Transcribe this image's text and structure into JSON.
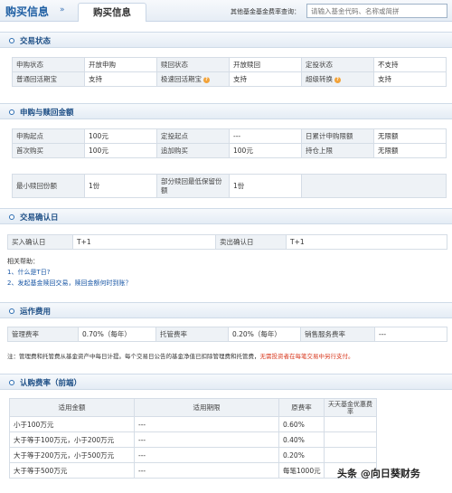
{
  "header": {
    "title": "购买信息",
    "double_arrow": "»",
    "tab": "购买信息",
    "query_label": "其他基金基金费率查询：",
    "search_placeholder": "请输入基金代码、名称或简拼"
  },
  "sections": {
    "trade_status": "交易状态",
    "amount": "申购与赎回金额",
    "confirm": "交易确认日",
    "fees": "运作费用",
    "subscribe_fee": "认购费率（前端）"
  },
  "trade_status": {
    "rows": [
      [
        "申购状态",
        "开放申购",
        "赎回状态",
        "开放赎回",
        "定投状态",
        "不支持"
      ],
      [
        "普通回活期宝",
        "支持",
        "极速回活期宝",
        "支持",
        "超级转换",
        "支持"
      ]
    ]
  },
  "amount": {
    "rows": [
      [
        "申购起点",
        "100元",
        "定投起点",
        "---",
        "日累计申购限额",
        "无限额"
      ],
      [
        "首次购买",
        "100元",
        "追加购买",
        "100元",
        "持仓上限",
        "无限额"
      ]
    ],
    "min_row": [
      "最小赎回份额",
      "1份",
      "部分赎回最低保留份额",
      "1份"
    ]
  },
  "confirm": {
    "row": [
      "买入确认日",
      "T+1",
      "卖出确认日",
      "T+1"
    ],
    "help_title": "相关帮助：",
    "help_links": [
      "1、什么是T日?",
      "2、发起基金赎回交易，赎回金额何时到账？"
    ]
  },
  "fees": {
    "row": [
      "管理费率",
      "0.70%（每年）",
      "托管费率",
      "0.20%（每年）",
      "销售服务费率",
      "---"
    ],
    "note_prefix": "注：管理费和托管费从基金资产中每日计提。每个交易日公告的基金净值已扣除管理费和托管费，",
    "note_red": "无需投资者在每笔交易中另行支付。"
  },
  "subscribe_fee": {
    "headers": [
      "适用金额",
      "适用期限",
      "原费率",
      "天天基金优惠费率"
    ],
    "rows": [
      [
        "小于100万元",
        "---",
        "0.60%",
        ""
      ],
      [
        "大于等于100万元，小于200万元",
        "---",
        "0.40%",
        ""
      ],
      [
        "大于等于200万元，小于500万元",
        "---",
        "0.20%",
        ""
      ],
      [
        "大于等于500万元",
        "---",
        "每笔1000元",
        ""
      ]
    ]
  },
  "watermark": "头条 @向日葵财务"
}
